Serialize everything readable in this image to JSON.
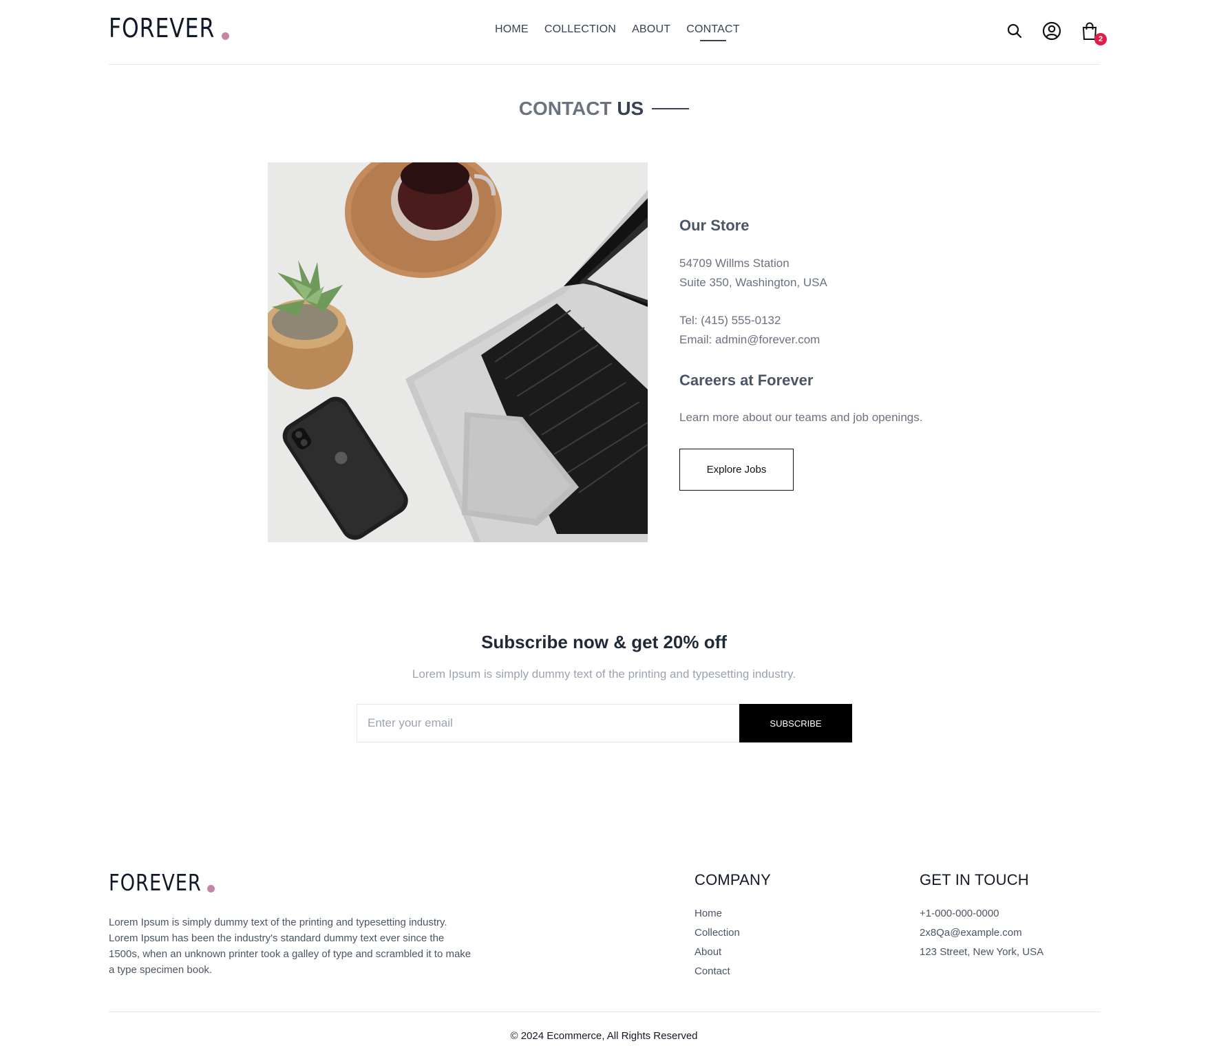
{
  "brand": {
    "logo_text": "FOREVER",
    "dot_color": "#c586a5"
  },
  "nav": {
    "items": [
      {
        "label": "HOME"
      },
      {
        "label": "COLLECTION"
      },
      {
        "label": "ABOUT"
      },
      {
        "label": "CONTACT",
        "active": true
      }
    ]
  },
  "header_icons": {
    "search": "search-icon",
    "profile": "user-icon",
    "cart": "cart-icon",
    "cart_count": "2"
  },
  "page": {
    "title_light": "CONTACT",
    "title_bold": "US"
  },
  "store": {
    "heading": "Our Store",
    "address_line1": "54709 Willms Station",
    "address_line2": "Suite 350, Washington, USA",
    "tel": "Tel: (415) 555-0132",
    "email": "Email: admin@forever.com"
  },
  "careers": {
    "heading": "Careers at Forever",
    "text": "Learn more about our teams and job openings.",
    "button_label": "Explore Jobs"
  },
  "newsletter": {
    "title": "Subscribe now & get 20% off",
    "text": "Lorem Ipsum is simply dummy text of the printing and typesetting industry.",
    "placeholder": "Enter your email",
    "button_label": "SUBSCRIBE"
  },
  "footer": {
    "description": "Lorem Ipsum is simply dummy text of the printing and typesetting industry. Lorem Ipsum has been the industry's standard dummy text ever since the 1500s, when an unknown printer took a galley of type and scrambled it to make a type specimen book.",
    "company_heading": "COMPANY",
    "company_links": [
      "Home",
      "Collection",
      "About",
      "Contact"
    ],
    "touch_heading": "GET IN TOUCH",
    "touch_items": [
      "+1-000-000-0000",
      "2x8Qa@example.com",
      "123 Street, New York, USA"
    ],
    "copyright": "© 2024 Ecommerce, All Rights Reserved"
  },
  "colors": {
    "badge": "#e11d48",
    "accent_dot": "#c586a5",
    "button_bg": "#000000"
  }
}
